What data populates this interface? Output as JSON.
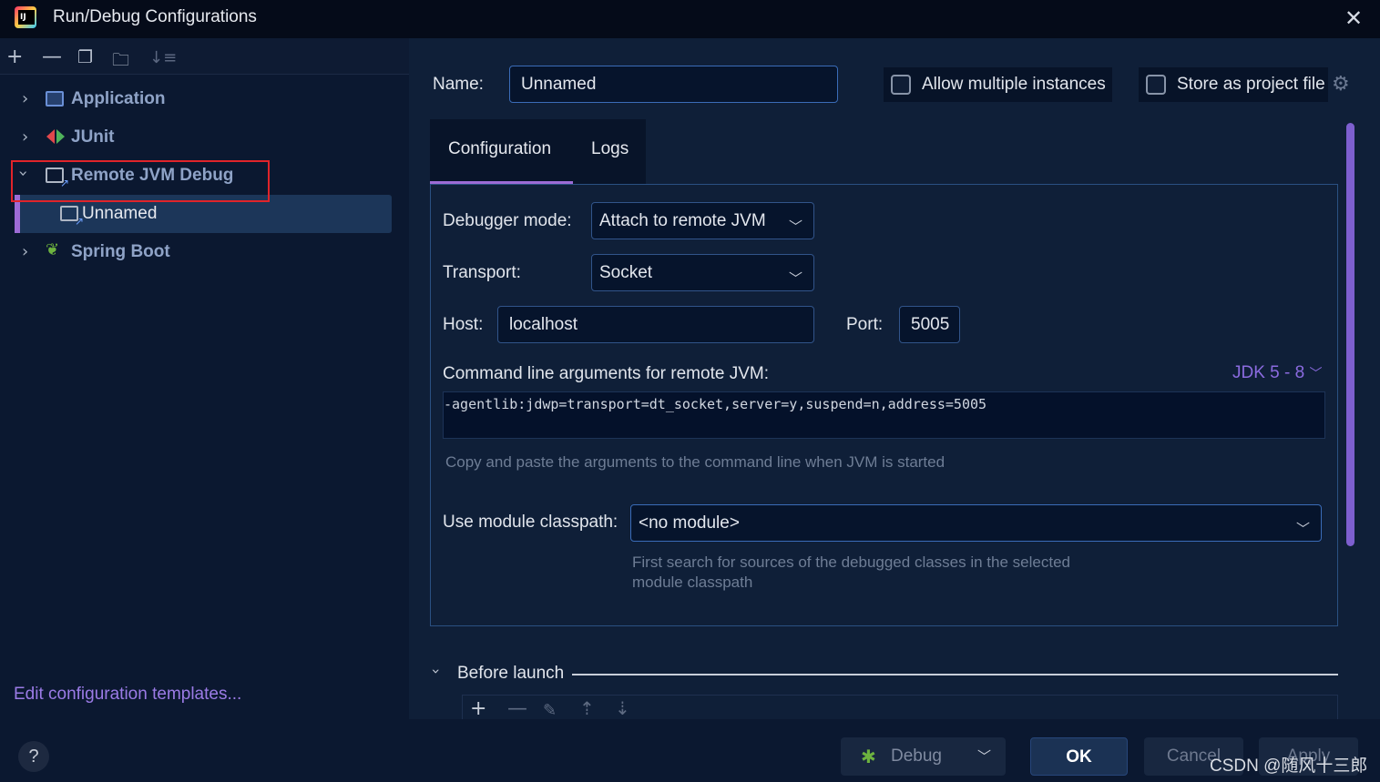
{
  "window": {
    "title": "Run/Debug Configurations"
  },
  "tree": {
    "items": [
      {
        "label": "Application",
        "icon": "application-icon",
        "expanded": false
      },
      {
        "label": "JUnit",
        "icon": "junit-icon",
        "expanded": false
      },
      {
        "label": "Remote JVM Debug",
        "icon": "remote-jvm-debug-icon",
        "expanded": true,
        "children": [
          {
            "label": "Unnamed",
            "icon": "remote-jvm-debug-icon",
            "selected": true
          }
        ]
      },
      {
        "label": "Spring Boot",
        "icon": "spring-boot-icon",
        "expanded": false
      }
    ],
    "edit_templates_link": "Edit configuration templates..."
  },
  "form": {
    "name_label": "Name:",
    "name_value": "Unnamed",
    "allow_multiple_label": "Allow multiple instances",
    "allow_multiple_checked": false,
    "store_project_label": "Store as project file",
    "store_project_checked": false,
    "tabs": [
      {
        "label": "Configuration",
        "active": true
      },
      {
        "label": "Logs",
        "active": false
      }
    ],
    "debugger_mode_label": "Debugger mode:",
    "debugger_mode_value": "Attach to remote JVM",
    "transport_label": "Transport:",
    "transport_value": "Socket",
    "host_label": "Host:",
    "host_value": "localhost",
    "port_label": "Port:",
    "port_value": "5005",
    "cmd_label": "Command line arguments for remote JVM:",
    "jdk_label": "JDK 5 - 8",
    "cmd_value": "-agentlib:jdwp=transport=dt_socket,server=y,suspend=n,address=5005",
    "cmd_hint": "Copy and paste the arguments to the command line when JVM is started",
    "module_label": "Use module classpath:",
    "module_value": "<no module>",
    "module_hint_1": "First search for sources of the debugged classes in the selected",
    "module_hint_2": "module classpath",
    "before_launch_label": "Before launch"
  },
  "buttons": {
    "debug": "Debug",
    "ok": "OK",
    "cancel": "Cancel",
    "apply": "Apply",
    "help": "?"
  },
  "watermark": "CSDN @随风十三郎",
  "colors": {
    "accent": "#9d6bd6",
    "highlight_box": "#e0242a",
    "link": "#9b7be6"
  }
}
